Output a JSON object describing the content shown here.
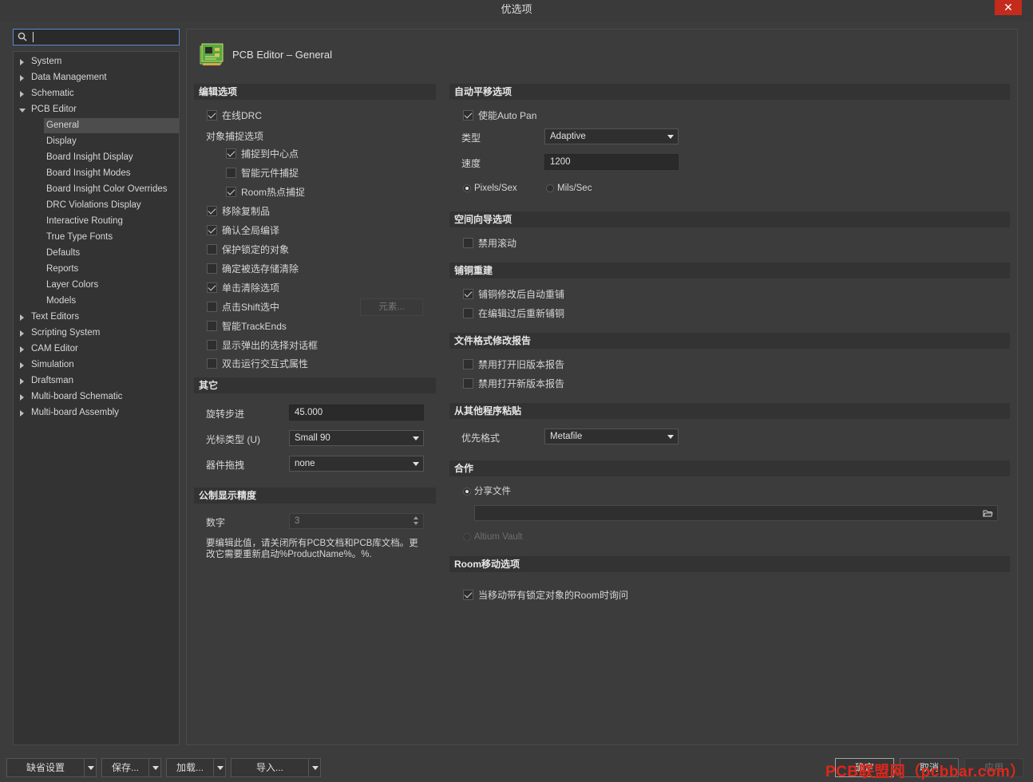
{
  "window": {
    "title": "优选项",
    "close_label": "✕"
  },
  "search": {
    "value": "",
    "placeholder": ""
  },
  "tree": {
    "items": [
      {
        "label": "System",
        "expanded": false
      },
      {
        "label": "Data Management",
        "expanded": false
      },
      {
        "label": "Schematic",
        "expanded": false
      },
      {
        "label": "PCB Editor",
        "expanded": true
      },
      {
        "label": "Text Editors",
        "expanded": false
      },
      {
        "label": "Scripting System",
        "expanded": false
      },
      {
        "label": "CAM Editor",
        "expanded": false
      },
      {
        "label": "Simulation",
        "expanded": false
      },
      {
        "label": "Draftsman",
        "expanded": false
      },
      {
        "label": "Multi-board Schematic",
        "expanded": false
      },
      {
        "label": "Multi-board Assembly",
        "expanded": false
      }
    ],
    "pcb_children": [
      "General",
      "Display",
      "Board Insight Display",
      "Board Insight Modes",
      "Board Insight Color Overrides",
      "DRC Violations Display",
      "Interactive Routing",
      "True Type Fonts",
      "Defaults",
      "Reports",
      "Layer Colors",
      "Models"
    ],
    "selected": "General"
  },
  "page": {
    "title": "PCB Editor – General"
  },
  "edit_options": {
    "header": "编辑选项",
    "online_drc": {
      "label": "在线DRC",
      "checked": true
    },
    "snap_group_label": "对象捕捉选项",
    "snap_center": {
      "label": "捕捉到中心点",
      "checked": true
    },
    "smart_component_snap": {
      "label": "智能元件捕捉",
      "checked": false
    },
    "room_hotspot_snap": {
      "label": "Room热点捕捉",
      "checked": true
    },
    "remove_duplicates": {
      "label": "移除复制品",
      "checked": true
    },
    "confirm_global_edit": {
      "label": "确认全局编译",
      "checked": true
    },
    "protect_locked": {
      "label": "保护锁定的对象",
      "checked": false
    },
    "confirm_clear_selection_memory": {
      "label": "确定被选存储清除",
      "checked": false
    },
    "click_clear_selection": {
      "label": "单击清除选项",
      "checked": true
    },
    "shift_click_select": {
      "label": "点击Shift选中",
      "checked": false
    },
    "primitives_button": "元素...",
    "smart_track_ends": {
      "label": "智能TrackEnds",
      "checked": false
    },
    "show_popup_selection": {
      "label": "显示弹出的选择对话框",
      "checked": false
    },
    "double_click_inspector": {
      "label": "双击运行交互式属性",
      "checked": false
    }
  },
  "other": {
    "header": "其它",
    "rotation_step_label": "旋转步进",
    "rotation_step_value": "45.000",
    "cursor_type_label": "光标类型 (U)",
    "cursor_type_value": "Small 90",
    "comp_drag_label": "器件拖拽",
    "comp_drag_value": "none"
  },
  "metric_precision": {
    "header": "公制显示精度",
    "digits_label": "数字",
    "digits_value": "3",
    "note": "要编辑此值，请关闭所有PCB文档和PCB库文档。更改它需要重新启动%ProductName%。%."
  },
  "autopan": {
    "header": "自动平移选项",
    "enable": {
      "label": "使能Auto Pan",
      "checked": true
    },
    "type_label": "类型",
    "type_value": "Adaptive",
    "speed_label": "速度",
    "speed_value": "1200",
    "unit_pixels": {
      "label": "Pixels/Sex",
      "selected": true
    },
    "unit_mils": {
      "label": "Mils/Sec",
      "selected": false
    }
  },
  "space_navigator": {
    "header": "空间向导选项",
    "disable_roll": {
      "label": "禁用滚动",
      "checked": false
    }
  },
  "polygon_rebuild": {
    "header": "铺铜重建",
    "repour_after_modify": {
      "label": "铺铜修改后自动重铺",
      "checked": true
    },
    "repour_after_edit": {
      "label": "在编辑过后重新铺铜",
      "checked": false
    }
  },
  "file_format_report": {
    "header": "文件格式修改报告",
    "disable_old": {
      "label": "禁用打开旧版本报告",
      "checked": false
    },
    "disable_new": {
      "label": "禁用打开新版本报告",
      "checked": false
    }
  },
  "paste_from_other": {
    "header": "从其他程序粘贴",
    "preferred_format_label": "优先格式",
    "preferred_format_value": "Metafile"
  },
  "collaboration": {
    "header": "合作",
    "shared_files": {
      "label": "分享文件",
      "selected": true
    },
    "path_value": "",
    "altium_vault": {
      "label": "Altium Vault",
      "selected": false
    }
  },
  "room_move": {
    "header": "Room移动选项",
    "ask_when_locked": {
      "label": "当移动带有锁定对象的Room时询问",
      "checked": true
    }
  },
  "bottom": {
    "defaults": "缺省设置",
    "save": "保存...",
    "load": "加载...",
    "import": "导入...",
    "ok": "确定",
    "cancel": "取消",
    "apply": "应用"
  },
  "watermark": "PCB联盟网（pcbbar.com）",
  "colors": {
    "accent": "#5a8bc9",
    "close": "#c42b1c",
    "watermark": "#e0261a"
  }
}
